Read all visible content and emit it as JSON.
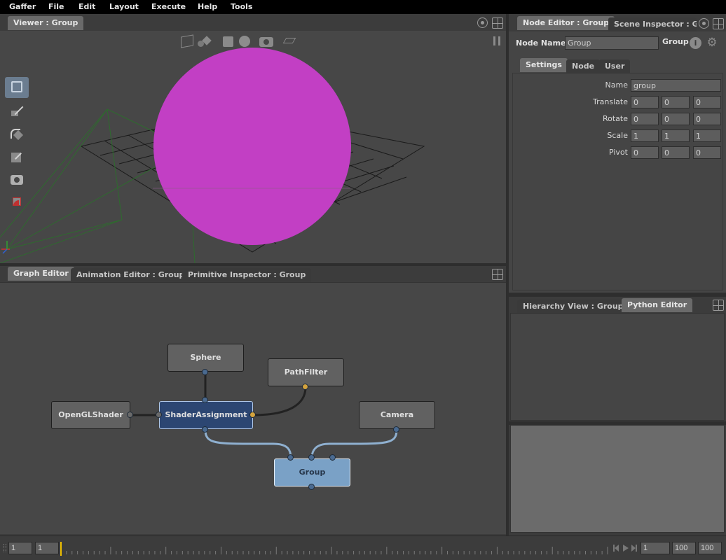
{
  "menubar": {
    "items": [
      "Gaffer",
      "File",
      "Edit",
      "Layout",
      "Execute",
      "Help",
      "Tools"
    ]
  },
  "viewer": {
    "tab_label": "Viewer : Group",
    "toolbar_icons": [
      "wireframe-box-icon",
      "shaded-spheres-icon",
      "box-icon",
      "sphere-icon",
      "camera-icon",
      "layer-icon"
    ],
    "pause_icon": "pause-icon",
    "tools": [
      "selection-tool-icon",
      "translate-tool-icon",
      "rotate-tool-icon",
      "scale-tool-icon",
      "camera-tool-icon",
      "crop-window-tool-icon"
    ],
    "sphere_color": "#c23fc4"
  },
  "node_editor": {
    "tabs": [
      "Node Editor : Group",
      "Scene Inspector : Gro"
    ],
    "node_name_label": "Node Name",
    "node_name_value": "Group",
    "node_type": "Group",
    "sub_tabs": [
      "Settings",
      "Node",
      "User"
    ],
    "params": {
      "name": {
        "label": "Name",
        "value": "group"
      },
      "translate": {
        "label": "Translate",
        "values": [
          "0",
          "0",
          "0"
        ]
      },
      "rotate": {
        "label": "Rotate",
        "values": [
          "0",
          "0",
          "0"
        ]
      },
      "scale": {
        "label": "Scale",
        "values": [
          "1",
          "1",
          "1"
        ]
      },
      "pivot": {
        "label": "Pivot",
        "values": [
          "0",
          "0",
          "0"
        ]
      }
    }
  },
  "graph_editor": {
    "tabs": [
      "Graph Editor",
      "Animation Editor : Group",
      "Primitive Inspector : Group"
    ],
    "nodes": {
      "sphere": "Sphere",
      "pathfilter": "PathFilter",
      "openglshader": "OpenGLShader",
      "shaderassignment": "ShaderAssignment",
      "camera": "Camera",
      "group": "Group"
    }
  },
  "bottom_right": {
    "tabs": [
      "Hierarchy View : Group",
      "Python Editor"
    ]
  },
  "timeline": {
    "start_frame": "1",
    "current_frame_left": "1",
    "current_frame": "1",
    "end_frame": "100",
    "range_end": "100"
  }
}
